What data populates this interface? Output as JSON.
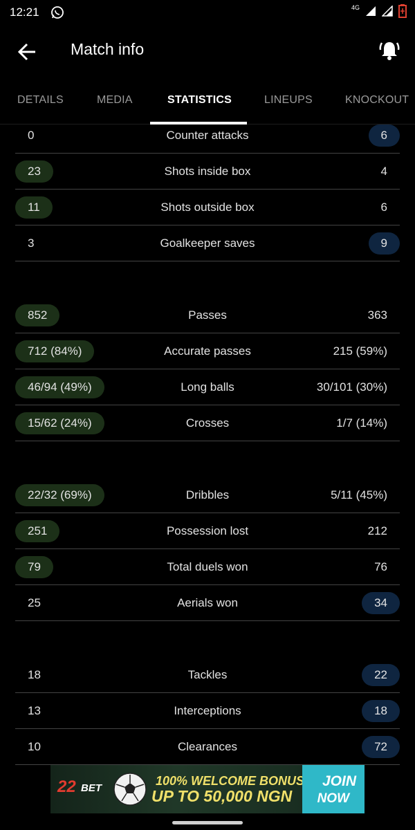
{
  "status": {
    "time": "12:21",
    "network": "4G"
  },
  "header": {
    "title": "Match info",
    "back_icon": "arrow-left-icon",
    "bell_icon": "bell-ringing-icon"
  },
  "tabs": [
    {
      "label": "DETAILS"
    },
    {
      "label": "MEDIA"
    },
    {
      "label": "STATISTICS",
      "active": true
    },
    {
      "label": "LINEUPS"
    },
    {
      "label": "KNOCKOUT"
    }
  ],
  "colors": {
    "home_highlight": "#1c3018",
    "away_highlight": "#0f2540",
    "row_divider": "#444444"
  },
  "groups": [
    {
      "rows": [
        {
          "home": "0",
          "label": "Counter attacks",
          "away": "6",
          "winner": "away"
        },
        {
          "home": "23",
          "label": "Shots inside box",
          "away": "4",
          "winner": "home"
        },
        {
          "home": "11",
          "label": "Shots outside box",
          "away": "6",
          "winner": "home"
        },
        {
          "home": "3",
          "label": "Goalkeeper saves",
          "away": "9",
          "winner": "away"
        }
      ]
    },
    {
      "rows": [
        {
          "home": "852",
          "label": "Passes",
          "away": "363",
          "winner": "home"
        },
        {
          "home": "712 (84%)",
          "label": "Accurate passes",
          "away": "215 (59%)",
          "winner": "home"
        },
        {
          "home": "46/94 (49%)",
          "label": "Long balls",
          "away": "30/101 (30%)",
          "winner": "home"
        },
        {
          "home": "15/62 (24%)",
          "label": "Crosses",
          "away": "1/7 (14%)",
          "winner": "home"
        }
      ]
    },
    {
      "rows": [
        {
          "home": "22/32 (69%)",
          "label": "Dribbles",
          "away": "5/11 (45%)",
          "winner": "home"
        },
        {
          "home": "251",
          "label": "Possession lost",
          "away": "212",
          "winner": "home"
        },
        {
          "home": "79",
          "label": "Total duels won",
          "away": "76",
          "winner": "home"
        },
        {
          "home": "25",
          "label": "Aerials won",
          "away": "34",
          "winner": "away"
        }
      ]
    },
    {
      "rows": [
        {
          "home": "18",
          "label": "Tackles",
          "away": "22",
          "winner": "away"
        },
        {
          "home": "13",
          "label": "Interceptions",
          "away": "18",
          "winner": "away"
        },
        {
          "home": "10",
          "label": "Clearances",
          "away": "72",
          "winner": "away"
        }
      ]
    }
  ],
  "ad": {
    "logo_num": "22",
    "logo_bet": "BET",
    "line1": "100% WELCOME BONUS",
    "line2": "UP TO 50,000 NGN",
    "cta1": "JOIN",
    "cta2": "NOW"
  }
}
